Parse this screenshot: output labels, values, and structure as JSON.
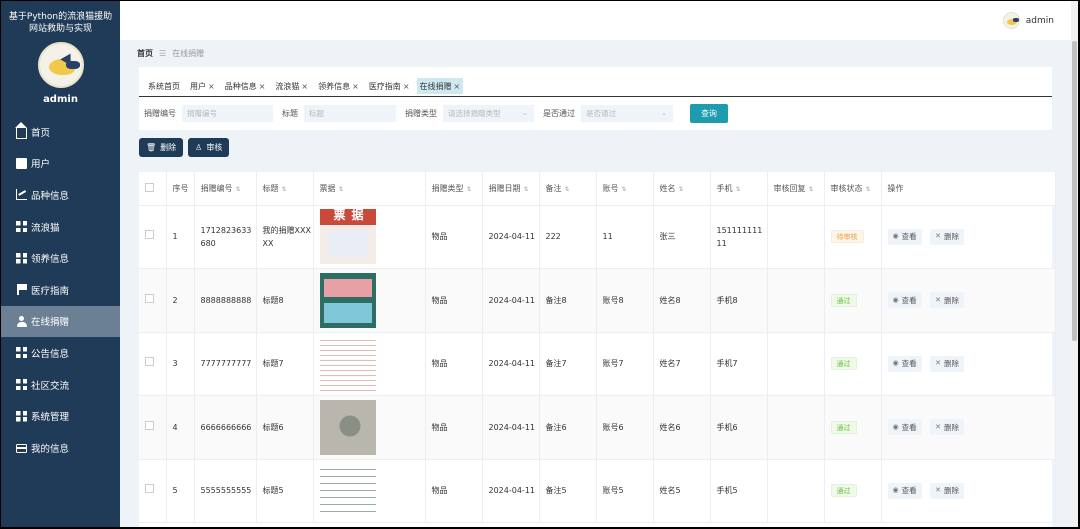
{
  "sidebar": {
    "title": "基于Python的流浪猫援助网站救助与实现",
    "username": "admin",
    "items": [
      {
        "label": "首页",
        "icon": "home-icon"
      },
      {
        "label": "用户",
        "icon": "clipboard-icon"
      },
      {
        "label": "品种信息",
        "icon": "chart-icon"
      },
      {
        "label": "流浪猫",
        "icon": "grid-icon"
      },
      {
        "label": "领养信息",
        "icon": "grid-icon"
      },
      {
        "label": "医疗指南",
        "icon": "flag-icon"
      },
      {
        "label": "在线捐赠",
        "icon": "user-icon",
        "active": true
      },
      {
        "label": "公告信息",
        "icon": "grid-icon"
      },
      {
        "label": "社区交流",
        "icon": "grid-icon"
      },
      {
        "label": "系统管理",
        "icon": "grid-icon"
      },
      {
        "label": "我的信息",
        "icon": "card-icon"
      }
    ]
  },
  "topbar": {
    "username": "admin"
  },
  "breadcrumb": {
    "home": "首页",
    "current": "在线捐赠"
  },
  "tabs": [
    {
      "label": "系统首页",
      "closable": false
    },
    {
      "label": "用户",
      "closable": true
    },
    {
      "label": "品种信息",
      "closable": true
    },
    {
      "label": "流浪猫",
      "closable": true
    },
    {
      "label": "领养信息",
      "closable": true
    },
    {
      "label": "医疗指南",
      "closable": true
    },
    {
      "label": "在线捐赠",
      "closable": true,
      "active": true
    }
  ],
  "search": {
    "id_label": "捐赠编号",
    "id_placeholder": "捐赠编号",
    "title_label": "标题",
    "title_placeholder": "标题",
    "type_label": "捐赠类型",
    "type_placeholder": "请选择捐赠类型",
    "pass_label": "是否通过",
    "pass_placeholder": "是否通过",
    "query_button": "查询"
  },
  "actions": {
    "delete": "删除",
    "audit": "审核"
  },
  "table": {
    "headers": [
      "序号",
      "捐赠编号",
      "标题",
      "票据",
      "捐赠类型",
      "捐赠日期",
      "备注",
      "账号",
      "姓名",
      "手机",
      "审核回复",
      "审核状态",
      "操作"
    ],
    "view_label": "查看",
    "delete_label": "删除",
    "rows": [
      {
        "index": "1",
        "id": "1712823633680",
        "title": "我的捐赠XXXXX",
        "type": "物品",
        "date": "2024-04-11",
        "note": "222",
        "account": "11",
        "name": "张三",
        "phone": "15111111111",
        "reply": "",
        "status": "待审核",
        "status_kind": "wait"
      },
      {
        "index": "2",
        "id": "8888888888",
        "title": "标题8",
        "type": "物品",
        "date": "2024-04-11",
        "note": "备注8",
        "account": "账号8",
        "name": "姓名8",
        "phone": "手机8",
        "reply": "",
        "status": "通过",
        "status_kind": "pass"
      },
      {
        "index": "3",
        "id": "7777777777",
        "title": "标题7",
        "type": "物品",
        "date": "2024-04-11",
        "note": "备注7",
        "account": "账号7",
        "name": "姓名7",
        "phone": "手机7",
        "reply": "",
        "status": "通过",
        "status_kind": "pass"
      },
      {
        "index": "4",
        "id": "6666666666",
        "title": "标题6",
        "type": "物品",
        "date": "2024-04-11",
        "note": "备注6",
        "account": "账号6",
        "name": "姓名6",
        "phone": "手机6",
        "reply": "",
        "status": "通过",
        "status_kind": "pass"
      },
      {
        "index": "5",
        "id": "5555555555",
        "title": "标题5",
        "type": "物品",
        "date": "2024-04-11",
        "note": "备注5",
        "account": "账号5",
        "name": "姓名5",
        "phone": "手机5",
        "reply": "",
        "status": "通过",
        "status_kind": "pass"
      }
    ]
  },
  "receipt_image_text": "票据"
}
